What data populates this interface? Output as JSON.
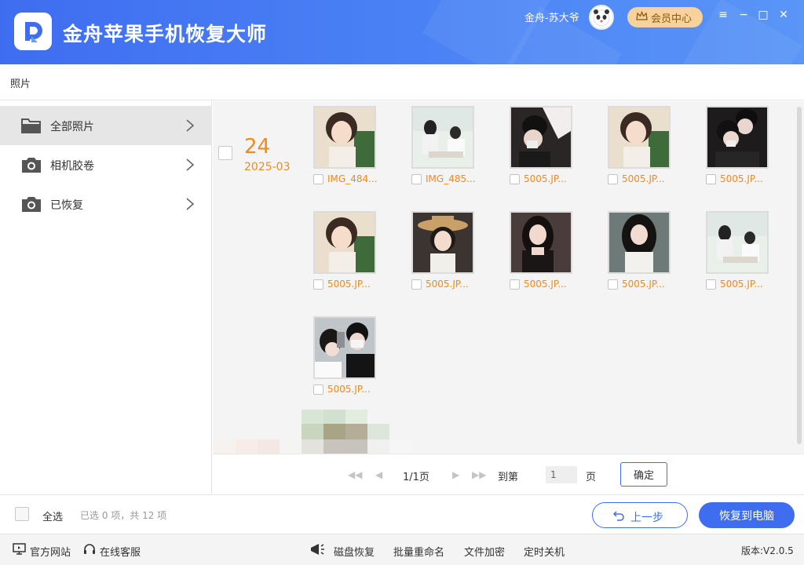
{
  "app": {
    "title": "金舟苹果手机恢复大师",
    "username": "金舟-苏大爷",
    "member_label": "会员中心"
  },
  "window_controls": [
    "≡",
    "−",
    "□",
    "✕"
  ],
  "breadcrumb": "照片",
  "sidebar": {
    "items": [
      {
        "label": "全部照片",
        "icon": "folder-icon",
        "active": true
      },
      {
        "label": "相机胶卷",
        "icon": "camera-icon",
        "active": false
      },
      {
        "label": "已恢复",
        "icon": "camera-icon",
        "active": false
      }
    ]
  },
  "gallery": {
    "group": {
      "day": "24",
      "month": "2025-03"
    },
    "photos": [
      {
        "name": "IMG_484..."
      },
      {
        "name": "IMG_485..."
      },
      {
        "name": "5005.JP..."
      },
      {
        "name": "5005.JP..."
      },
      {
        "name": "5005.JP..."
      },
      {
        "name": "5005.JP..."
      },
      {
        "name": "5005.JP..."
      },
      {
        "name": "5005.JP..."
      },
      {
        "name": "5005.JP..."
      },
      {
        "name": "5005.JP..."
      },
      {
        "name": "5005.JP..."
      }
    ]
  },
  "pager": {
    "info": "1/1页",
    "goto_label": "到第",
    "page_value": "1",
    "unit": "页",
    "confirm": "确定"
  },
  "actions": {
    "select_all": "全选",
    "selection_count": "已选 0 项，共 12 项",
    "prev": "上一步",
    "recover": "恢复到电脑"
  },
  "statusbar": {
    "website": "官方网站",
    "support": "在线客服",
    "tools": [
      "磁盘恢复",
      "批量重命名",
      "文件加密",
      "定时关机"
    ],
    "version": "版本:V2.0.5"
  },
  "colors": {
    "brand": "#3f6df0",
    "accent": "#f08a1c",
    "member": "#f7d29a"
  }
}
